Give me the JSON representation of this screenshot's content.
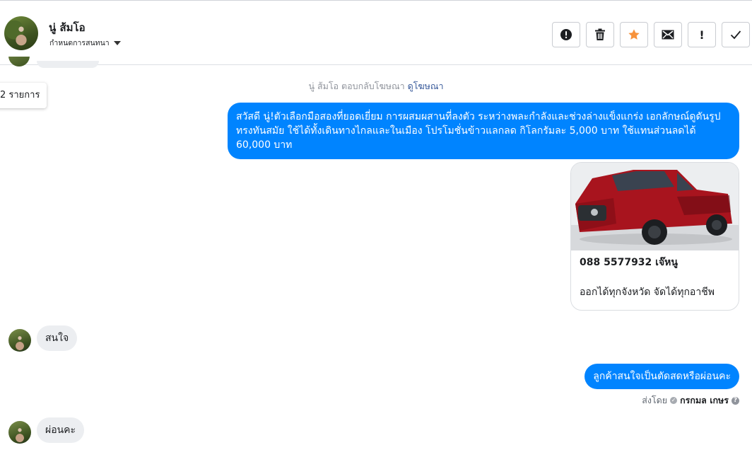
{
  "header": {
    "name": "นู่ ส้มโอ",
    "subtitle": "กำหนดการสนทนา",
    "actions": [
      {
        "icon": "alert-circle-icon",
        "label": ""
      },
      {
        "icon": "trash-icon",
        "label": ""
      },
      {
        "icon": "star-icon",
        "label": "",
        "color": "#f7923b"
      },
      {
        "icon": "envelope-icon",
        "label": ""
      },
      {
        "icon": "exclamation-icon",
        "label": "!"
      },
      {
        "icon": "checkmark-icon",
        "label": ""
      }
    ]
  },
  "tooltip": "2 รายการ",
  "ad_reply": {
    "text": "นู่ ส้มโอ ตอบกลับโฆษณา",
    "link": "ดูโฆษณา"
  },
  "messages": [
    {
      "type": "outgoing",
      "text": "สวัสดี นู่!ตัวเลือกมือสองที่ยอดเยี่ยม การผสมผสานที่ลงตัว ระหว่างพละกำลังและช่วงล่างแข็งแกร่ง เอกลักษณ์ดูดันรูปทรงทันสมัย ใช้ได้ทั้งเดินทางไกลและในเมือง โปรโมชั่นข้าวแลกลด กิโลกรัมละ 5,000 บาท ใช้แทนส่วนลดได้ 60,000 บาท"
    },
    {
      "type": "card",
      "title": "088 5577932 เจ๊หนู",
      "description": "ออกได้ทุกจังหวัด จัดได้ทุกอาชีพ"
    },
    {
      "type": "incoming",
      "text": "สนใจ"
    },
    {
      "type": "outgoing",
      "text": "ลูกค้าสนใจเป็นตัดสดหรือผ่อนคะ"
    },
    {
      "type": "incoming",
      "text": "ผ่อนคะ"
    }
  ],
  "sent_by": {
    "prefix": "ส่งโดย",
    "name": "กรกมล เกษร"
  },
  "colors": {
    "outgoing_bubble": "#0084ff",
    "incoming_bubble": "#eceef1",
    "star": "#f7923b",
    "link": "#365899"
  }
}
